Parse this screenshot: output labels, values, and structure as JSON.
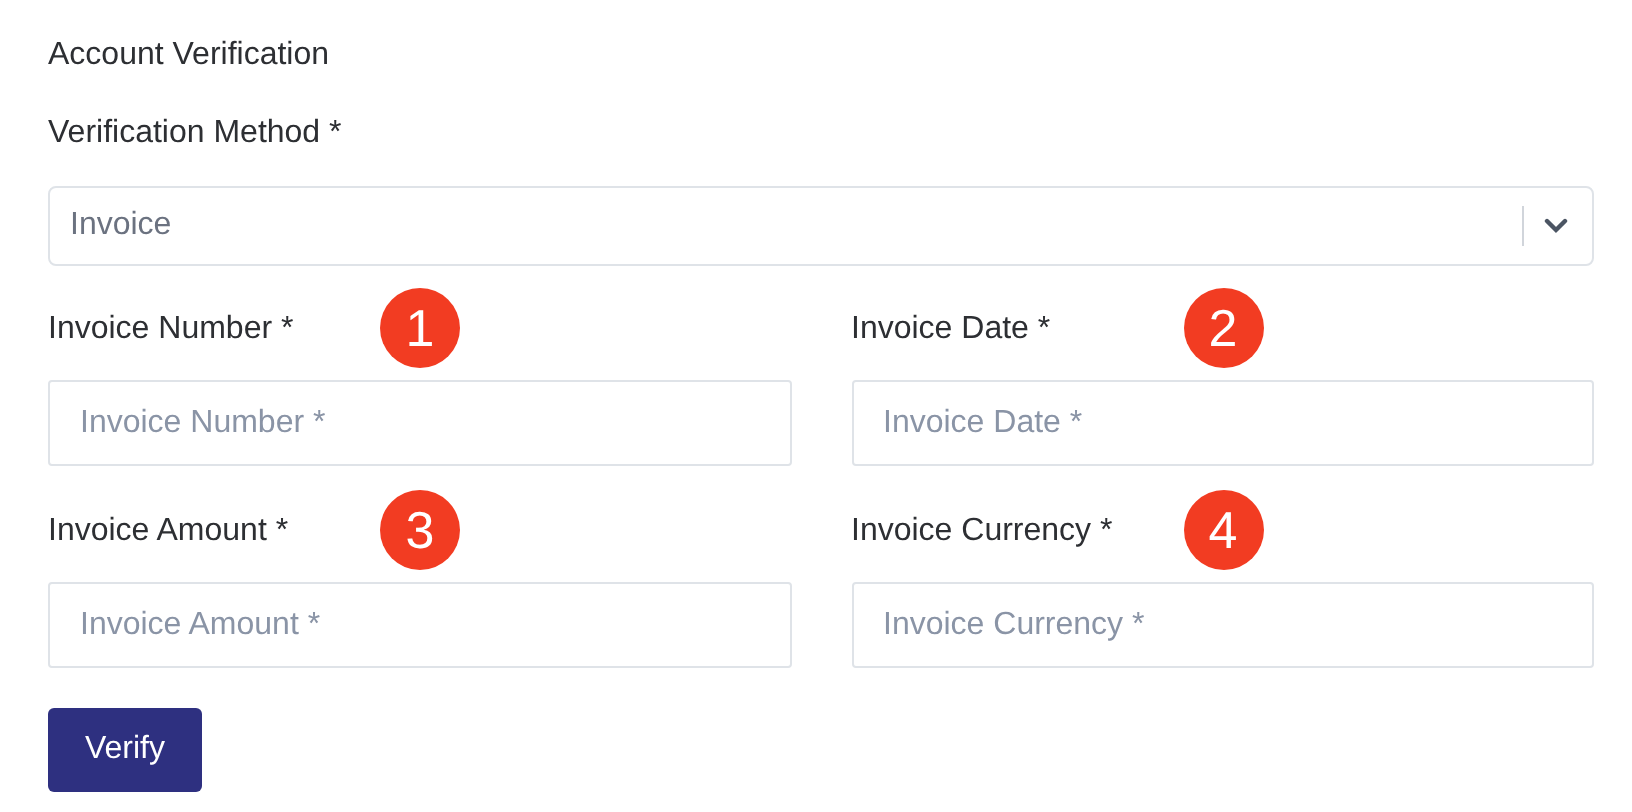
{
  "title": "Account Verification",
  "method": {
    "label": "Verification Method *",
    "value": "Invoice"
  },
  "fields": [
    {
      "label": "Invoice Number *",
      "placeholder": "Invoice Number *",
      "badge": "1"
    },
    {
      "label": "Invoice Date *",
      "placeholder": "Invoice Date *",
      "badge": "2"
    },
    {
      "label": "Invoice Amount *",
      "placeholder": "Invoice Amount *",
      "badge": "3"
    },
    {
      "label": "Invoice Currency *",
      "placeholder": "Invoice Currency *",
      "badge": "4"
    }
  ],
  "button": "Verify"
}
